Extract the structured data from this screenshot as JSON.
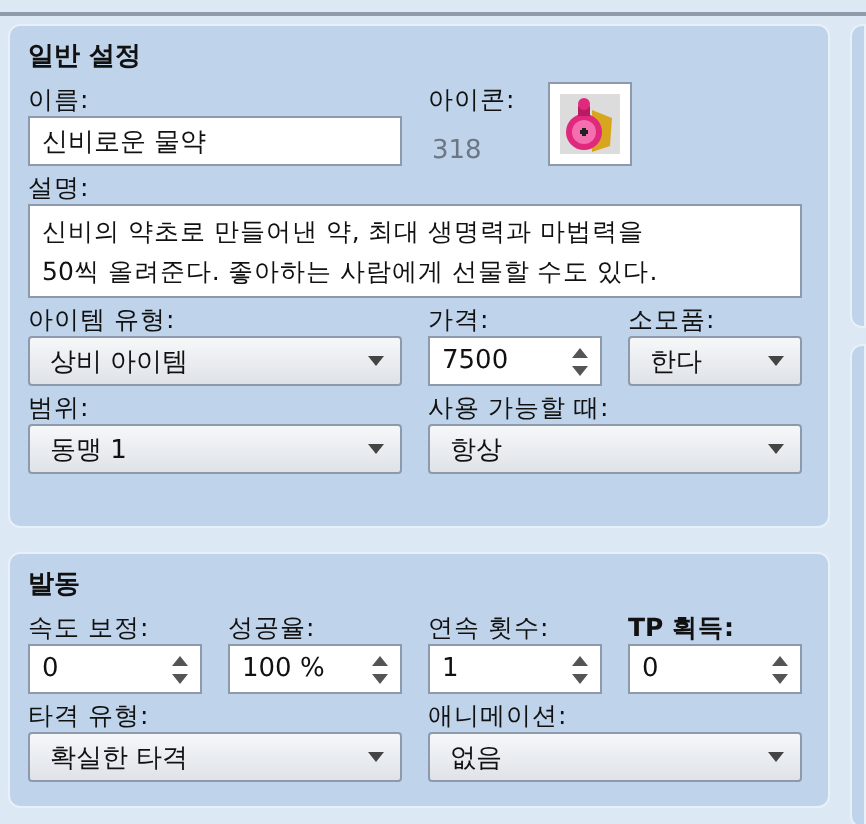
{
  "general": {
    "title": "일반 설정",
    "name": {
      "label": "이름:",
      "value": "신비로운 물약"
    },
    "icon": {
      "label": "아이콘:",
      "index": "318"
    },
    "description": {
      "label": "설명:",
      "value": "신비의 약초로 만들어낸 약, 최대 생명력과 마법력을\n50씩 올려준다. 좋아하는 사람에게 선물할 수도 있다."
    },
    "item_type": {
      "label": "아이템 유형:",
      "value": "상비 아이템"
    },
    "price": {
      "label": "가격:",
      "value": "7500"
    },
    "consumable": {
      "label": "소모품:",
      "value": "한다"
    },
    "scope": {
      "label": "범위:",
      "value": "동맹 1"
    },
    "occasion": {
      "label": "사용 가능할 때:",
      "value": "항상"
    }
  },
  "invocation": {
    "title": "발동",
    "speed": {
      "label": "속도 보정:",
      "value": "0"
    },
    "success": {
      "label": "성공율:",
      "value": "100 %"
    },
    "repeats": {
      "label": "연속 횟수:",
      "value": "1"
    },
    "tp_gain": {
      "label": "TP 획득:",
      "value": "0"
    },
    "hit_type": {
      "label": "타격 유형:",
      "value": "확실한 타격"
    },
    "animation": {
      "label": "애니메이션:",
      "value": "없음"
    }
  }
}
